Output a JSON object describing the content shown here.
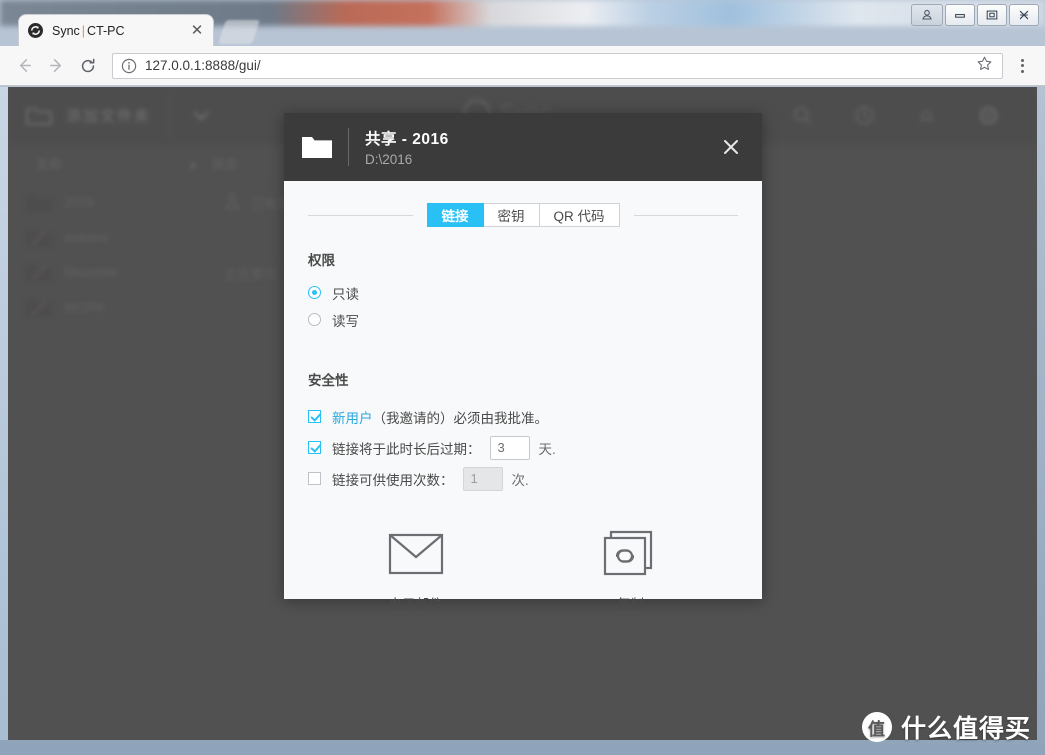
{
  "browser": {
    "tab": {
      "title_app": "Sync",
      "separator": "|",
      "title_host": "CT-PC",
      "favicon": "sync-icon",
      "close": "✕"
    },
    "toolbar": {
      "back": "back-arrow-icon",
      "forward": "forward-arrow-icon",
      "reload": "reload-icon",
      "info": "info-icon",
      "url_scheme": "127.0.0.1",
      "url": "127.0.0.1:8888/gui/",
      "star": "star-icon",
      "menu": "three-dot-menu-icon"
    },
    "window_controls": {
      "user": "user-account-icon",
      "minimize": "minimize-icon",
      "maximize": "maximize-icon",
      "close": "close-icon"
    }
  },
  "app": {
    "add_folder_label": "添加文件夹",
    "caret": "chevron-down-icon",
    "logo_text": "Sync",
    "tools": [
      "search-icon",
      "history-icon",
      "notification-icon",
      "settings-icon"
    ],
    "list_headers": {
      "name": "名称",
      "status": "状态",
      "sort": "▴"
    },
    "rows": [
      {
        "name": "2016",
        "status": "已有用户",
        "has_user_icon": true
      },
      {
        "name": "arduino",
        "status": "",
        "has_user_icon": false
      },
      {
        "name": "filecenter",
        "status": "正在索引",
        "has_user_icon": false
      },
      {
        "name": "WORK",
        "status": "",
        "has_user_icon": false
      }
    ]
  },
  "modal": {
    "folder_icon": "folder-icon",
    "title": "共享 - 2016",
    "path": "D:\\2016",
    "close": "✕",
    "tabs": [
      {
        "label": "链接",
        "active": true
      },
      {
        "label": "密钥",
        "active": false
      },
      {
        "label": "QR 代码",
        "active": false
      }
    ],
    "permissions": {
      "heading": "权限",
      "options": [
        {
          "label": "只读",
          "selected": true
        },
        {
          "label": "读写",
          "selected": false
        }
      ]
    },
    "security": {
      "heading": "安全性",
      "approve": {
        "checked": true,
        "link_text": "新用户",
        "rest_text": "（我邀请的）必须由我批准。"
      },
      "expire": {
        "checked": true,
        "prefix": "链接将于此时长后过期：",
        "value": "3",
        "unit": "天."
      },
      "uses": {
        "checked": false,
        "prefix": "链接可供使用次数：",
        "value": "1",
        "unit": "次."
      }
    },
    "actions": [
      {
        "label": "电子邮件",
        "icon": "envelope-icon"
      },
      {
        "label": "复制",
        "icon": "copy-link-icon"
      }
    ]
  },
  "watermark": {
    "badge": "值",
    "text": "什么值得买"
  },
  "colors": {
    "accent": "#29c0f5",
    "link": "#29a8e0",
    "modal_header": "#3b3b3b",
    "overlay": "#5a5a5a"
  }
}
